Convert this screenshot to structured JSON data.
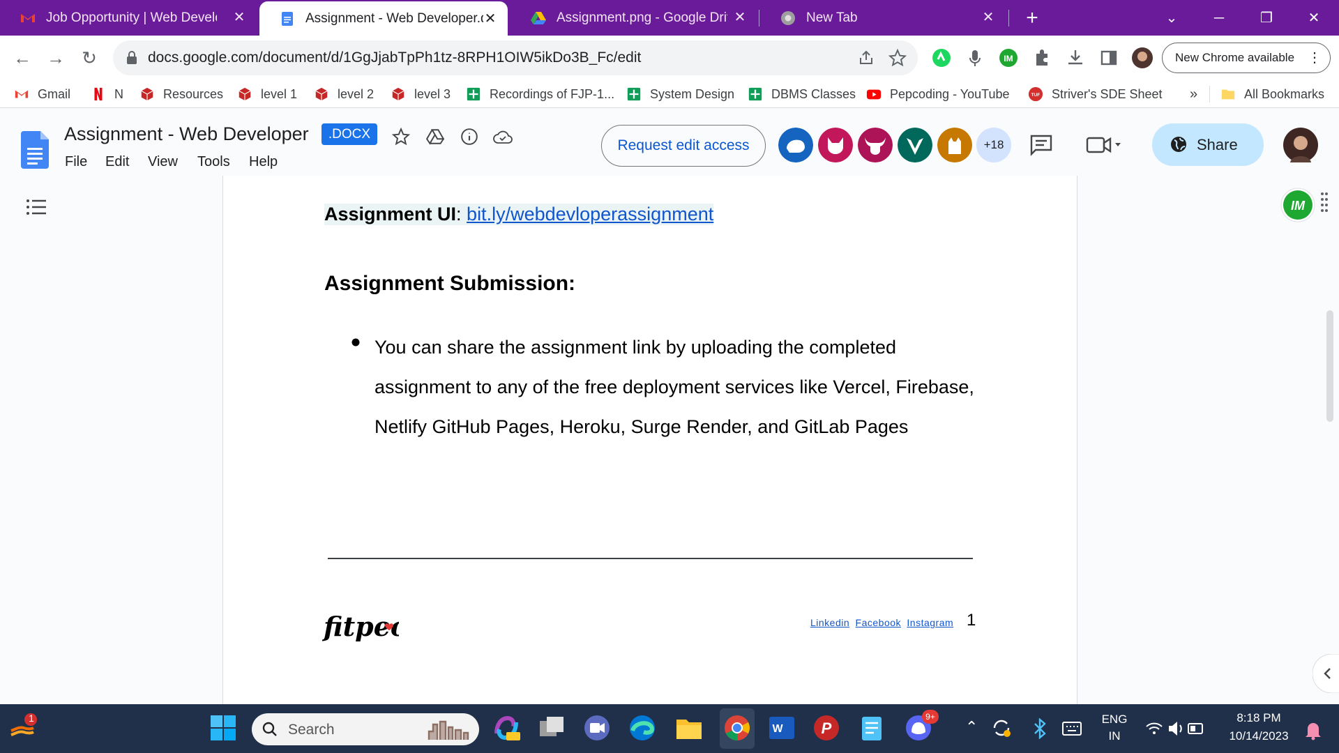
{
  "browser": {
    "tabs": [
      {
        "title": "Job Opportunity | Web Develope",
        "icon": "gmail-icon"
      },
      {
        "title": "Assignment - Web Developer.dc",
        "icon": "google-docs-icon",
        "active": true
      },
      {
        "title": "Assignment.png - Google Drive",
        "icon": "google-drive-icon"
      },
      {
        "title": "New Tab",
        "icon": "chrome-icon"
      }
    ],
    "url": "docs.google.com/document/d/1GgJjabTpPh1tz-8RPH1OIW5ikDo3B_Fc/edit",
    "new_chrome_label": "New Chrome available",
    "bookmarks": [
      "Gmail",
      "N",
      "Resources",
      "level 1",
      "level 2",
      "level 3",
      "Recordings of FJP-1...",
      "System Design",
      "DBMS Classes",
      "Pepcoding - YouTube",
      "Striver's SDE Sheet"
    ],
    "all_bookmarks": "All Bookmarks",
    "overflow": "»"
  },
  "docs": {
    "title": "Assignment - Web Developer",
    "badge": ".DOCX",
    "menu": [
      "File",
      "Edit",
      "View",
      "Tools",
      "Help"
    ],
    "request_edit": "Request edit access",
    "more_count": "+18",
    "share_label": "Share"
  },
  "document": {
    "ui_label": "Assignment UI",
    "ui_sep": ": ",
    "ui_link": "bit.ly/webdevloperassignment",
    "submission_heading": "Assignment Submission:",
    "bullet_text": "You can share the assignment link by uploading the completed assignment to any of the free deployment services like Vercel, Firebase, Netlify GitHub Pages, Heroku, Surge Render, and GitLab Pages",
    "footer_logo": "fitpeo",
    "footer_links": [
      "Linkedin",
      "Facebook",
      "Instagram"
    ],
    "page_number": "1"
  },
  "taskbar": {
    "notification_count": "1",
    "search_placeholder": "Search",
    "discord_badge": "9+",
    "language": "ENG",
    "region": "IN",
    "time": "8:18 PM",
    "date": "10/14/2023"
  },
  "colors": {
    "tabbar": "#6a1b9a",
    "accent": "#1a73e8",
    "share": "#c2e7ff",
    "taskbar": "#20304a"
  }
}
